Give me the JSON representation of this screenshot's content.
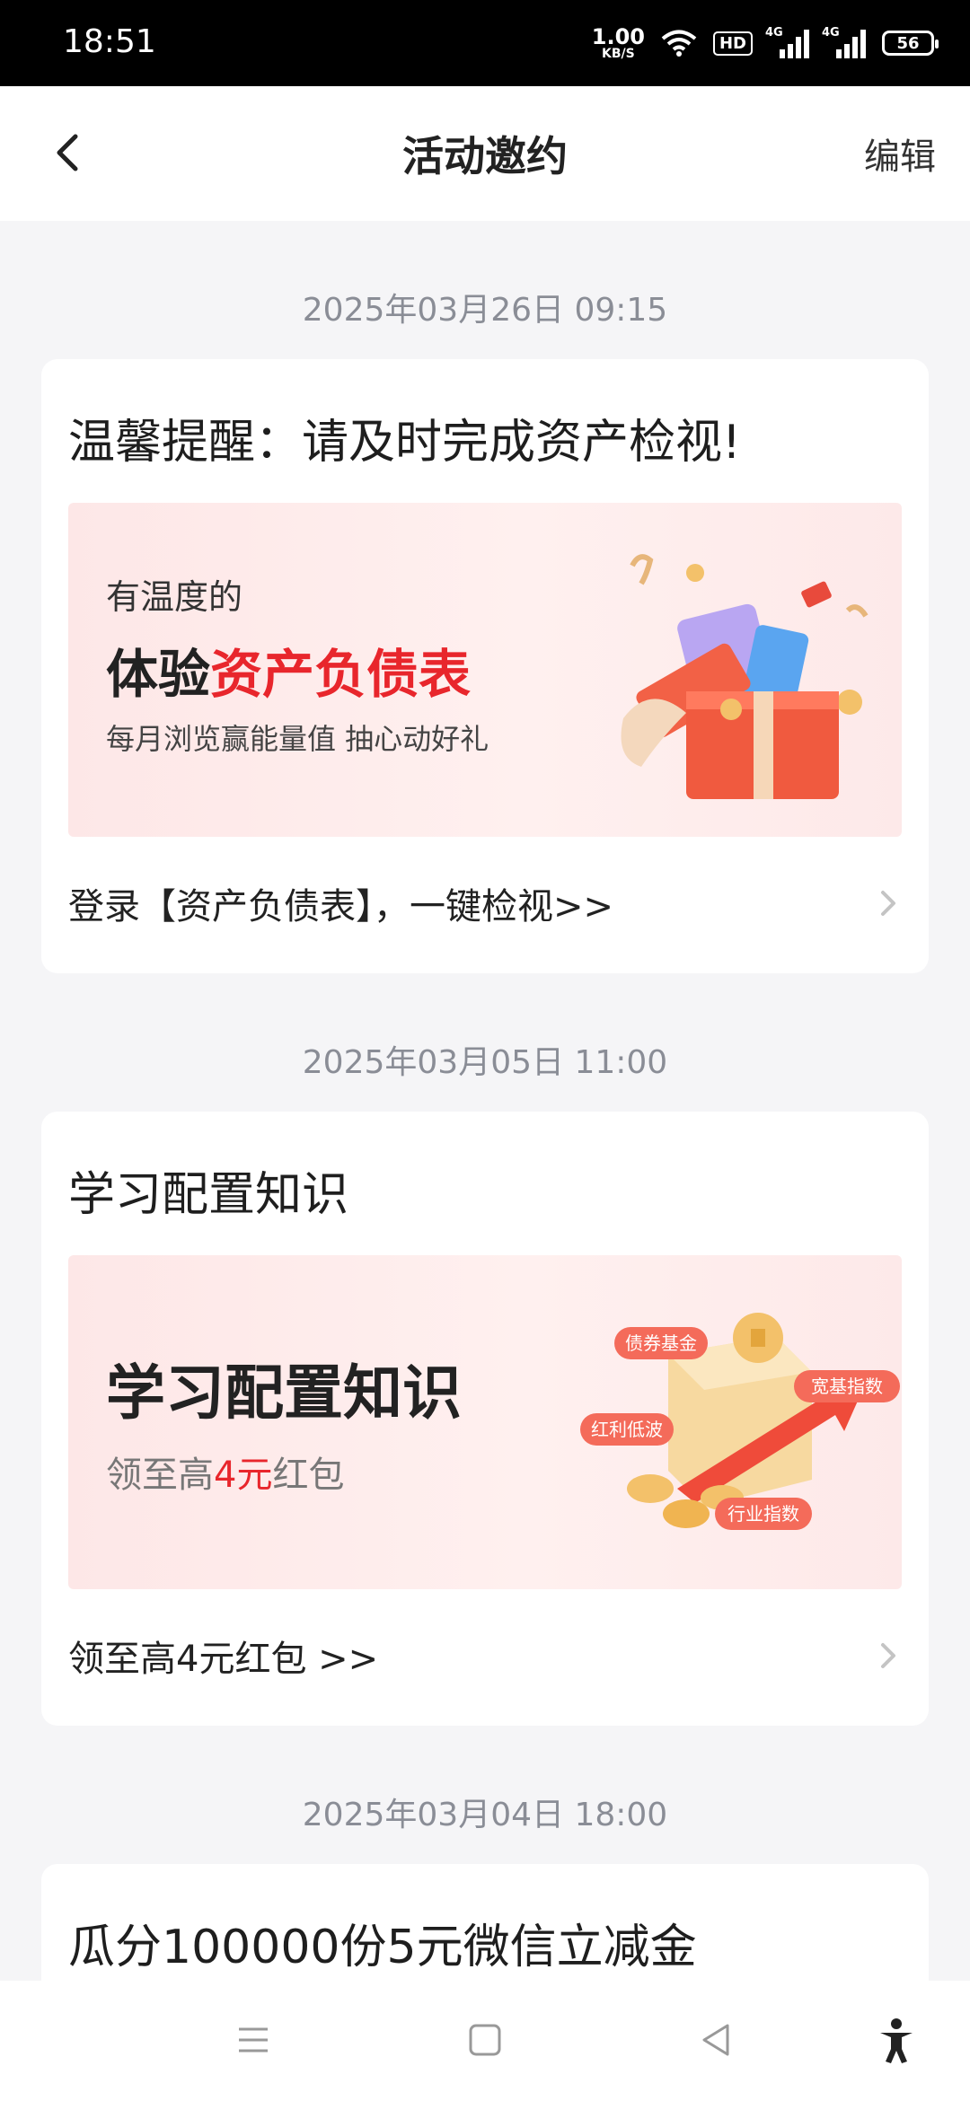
{
  "status_bar": {
    "time": "18:51",
    "net_speed_value": "1.00",
    "net_speed_unit": "KB/S",
    "hd_label": "HD",
    "signal1_label": "4G",
    "signal2_label": "4G",
    "battery": "56"
  },
  "header": {
    "title": "活动邀约",
    "edit_label": "编辑"
  },
  "messages": [
    {
      "date": "2025年03月26日 09:15",
      "title": "温馨提醒：请及时完成资产检视!",
      "banner": {
        "pre": "有温度的",
        "big_plain": "体验",
        "big_highlight": "资产负债表",
        "sub": "每月浏览赢能量值  抽心动好礼"
      },
      "footer": "登录【资产负债表】，一键检视>>"
    },
    {
      "date": "2025年03月05日 11:00",
      "title": "学习配置知识",
      "banner": {
        "big": "学习配置知识",
        "sub_pre": "领至高",
        "sub_highlight": "4元",
        "sub_post": "红包",
        "tags": [
          "债券基金",
          "宽基指数",
          "红利低波",
          "行业指数"
        ]
      },
      "footer": "领至高4元红包 >>"
    },
    {
      "date": "2025年03月04日 18:00",
      "title": "瓜分100000份5元微信立减金"
    }
  ],
  "colors": {
    "accent_red": "#e8262c",
    "background": "#f5f5f7",
    "date_text": "#8a8d96"
  },
  "icons": {
    "back": "chevron-left-icon",
    "card_arrow": "chevron-right-icon",
    "sys_menu": "menu-icon",
    "sys_home": "home-square-icon",
    "sys_back": "triangle-back-icon",
    "accessibility": "accessibility-icon"
  }
}
